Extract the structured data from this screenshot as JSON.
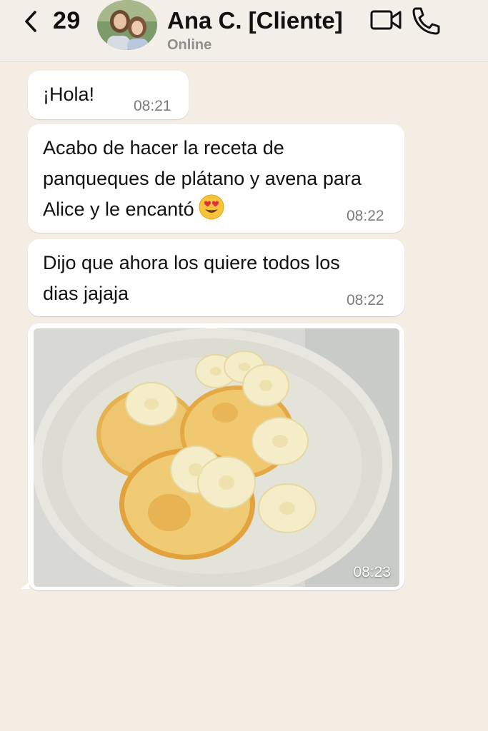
{
  "header": {
    "back_count": "29",
    "contact_name": "Ana C. [Cliente]",
    "status": "Online",
    "icons": {
      "back": "chevron-left-icon",
      "video": "video-camera-icon",
      "phone": "phone-icon"
    }
  },
  "messages": [
    {
      "text": "¡Hola!",
      "time": "08:21"
    },
    {
      "lines": [
        "Acabo de hacer la receta de",
        "panqueques de plátano y avena para",
        "Alice y le encantó"
      ],
      "emoji": "heart-eyes-emoji",
      "time": "08:22"
    },
    {
      "lines": [
        "Dijo que ahora los quiere todos los",
        "dias jajaja"
      ],
      "time": "08:22"
    },
    {
      "type": "image",
      "image": "banana-oat-pancakes-photo",
      "time": "08:23"
    }
  ],
  "colors": {
    "background": "#f4ede4",
    "bubble": "#ffffff",
    "time_text": "#7b7b7b",
    "status_text": "#8f8f8f"
  }
}
